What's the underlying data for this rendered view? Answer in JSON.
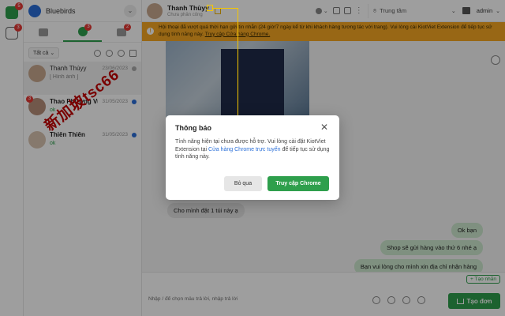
{
  "rail": {
    "app_badge": "5",
    "inbox_badge": "3"
  },
  "shop": {
    "name": "Bluebirds"
  },
  "channel_tabs": [
    {
      "icon": "chat-icon",
      "badge": ""
    },
    {
      "icon": "zalo-icon",
      "badge": "3"
    },
    {
      "icon": "message-icon",
      "badge": "2"
    }
  ],
  "filter": {
    "label": "Tất cả"
  },
  "conversations": [
    {
      "name": "Thanh Thùyy",
      "preview": "[ Hình ảnh ]",
      "date": "23/06/2023",
      "badge": ""
    },
    {
      "name": "Thao Phương Vu",
      "preview": "ok",
      "date": "31/05/2023",
      "badge": "3"
    },
    {
      "name": "Thiên Thiên",
      "preview": "ok",
      "date": "31/05/2023",
      "badge": ""
    }
  ],
  "watermark": "新加坡tsc66",
  "topbar": {
    "contact_name": "Thanh Thùyy",
    "contact_sub": "Chưa phân công",
    "branch": "Trung tâm",
    "user": "admin"
  },
  "banner": {
    "text": "Hội thoại đã vượt quá thời hạn gửi tin nhắn (24 giờ/7 ngày kể từ khi khách hàng tương tác với trang). Vui lòng cài KiotViet Extension để tiếp tục sử dụng tính năng này.",
    "link": "Truy cập Cửa hàng Chrome."
  },
  "messages": [
    {
      "dir": "in",
      "text": "Cho mình đặt 1 túi này ạ"
    },
    {
      "dir": "out",
      "text": "Ok bạn"
    },
    {
      "dir": "out",
      "text": "Shop sẽ gửi hàng vào thứ 6 nhé ạ"
    },
    {
      "dir": "out",
      "text": "Bạn vui lòng cho mình xin địa chỉ nhận hàng"
    }
  ],
  "composer": {
    "quick_reply": "+ Tạo nhãn",
    "placeholder": "Nhập / để chọn mẫu trả lời, nhập trả lời",
    "create_order": "Tạo đơn"
  },
  "modal": {
    "title": "Thông báo",
    "body_before": "Tính năng hiện tại chưa được hỗ trợ. Vui lòng cài đặt KiotViet Extension tại ",
    "body_link": "Cửa hàng Chrome trực tuyến",
    "body_after": " để tiếp tục sử dụng tính năng này.",
    "skip_label": "Bỏ qua",
    "chrome_label": "Truy cập Chrome"
  },
  "colors": {
    "accent": "#2e9f4c",
    "warning": "#f5a623",
    "link": "#2a6fd8"
  }
}
